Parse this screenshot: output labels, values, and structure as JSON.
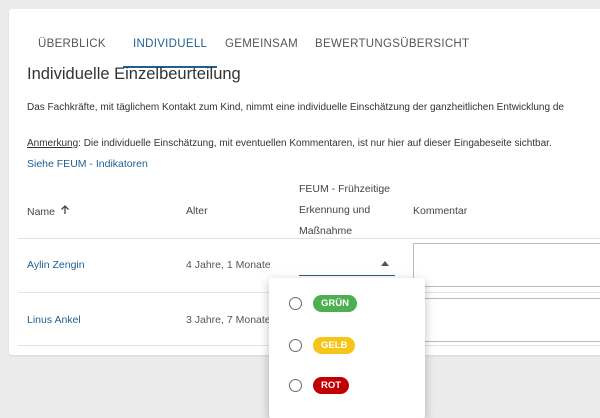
{
  "tabs": [
    {
      "label": "Überblick"
    },
    {
      "label": "Individuell"
    },
    {
      "label": "Gemeinsam"
    },
    {
      "label": "Bewertungsübersicht"
    }
  ],
  "active_tab": "Individuell",
  "page": {
    "title": "Individuelle Einzelbeurteilung",
    "description": "Das Fachkräfte, mit täglichem Kontakt zum Kind, nimmt eine individuelle Einschätzung der ganzheitlichen Entwicklung de",
    "note_label": "Anmerkung",
    "note_text": ": Die individuelle Einschätzung, mit eventuellen Kommentaren, ist nur hier auf dieser Eingabeseite sichtbar.",
    "feum_link": "Siehe FEUM - Indikatoren"
  },
  "table": {
    "columns": {
      "name": "Name",
      "age": "Alter",
      "feum": "FEUM - Frühzeitige Erkennung und Maßnahme",
      "comment": "Kommentar"
    },
    "rows": [
      {
        "name": "Aylin Zengin",
        "age": "4 Jahre, 1 Monate"
      },
      {
        "name": "Linus Ankel",
        "age": "3 Jahre, 7 Monate"
      }
    ]
  },
  "dropdown": {
    "options": [
      {
        "label": "GRÜN",
        "color": "#4caf50"
      },
      {
        "label": "GELB",
        "color": "#f5c518"
      },
      {
        "label": "ROT",
        "color": "#c00000"
      }
    ]
  }
}
